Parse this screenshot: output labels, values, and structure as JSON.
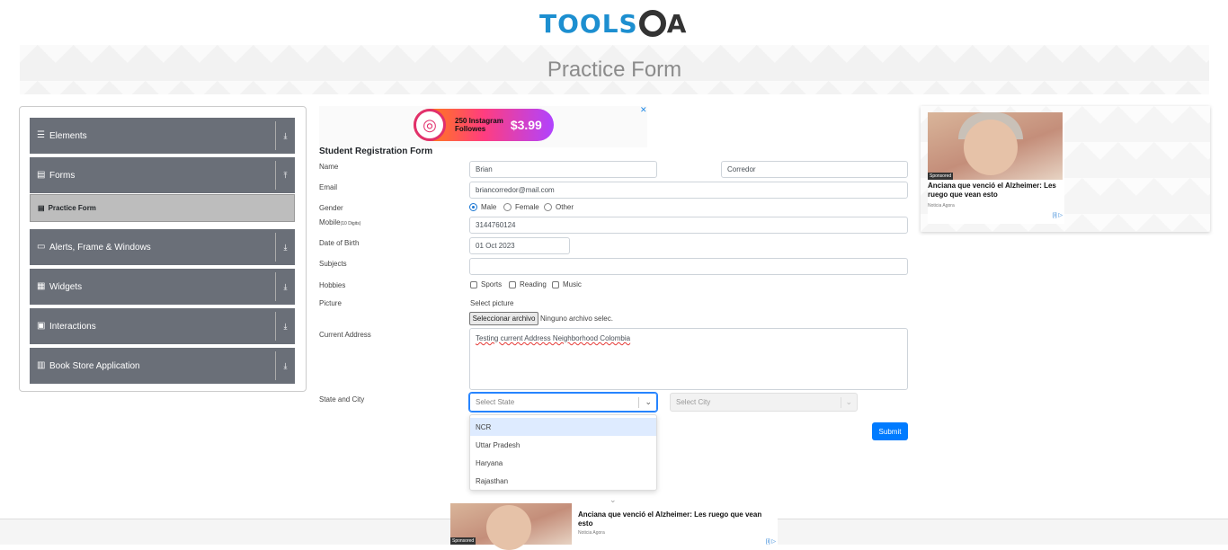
{
  "header": {
    "logo_text_left": "TOOLS",
    "logo_text_right": "A",
    "banner_title": "Practice Form"
  },
  "sidebar": {
    "groups": [
      {
        "label": "Elements",
        "icon": "menu-icon"
      },
      {
        "label": "Forms",
        "icon": "document-icon"
      },
      {
        "label": "Alerts, Frame & Windows",
        "icon": "window-icon"
      },
      {
        "label": "Widgets",
        "icon": "grid-icon"
      },
      {
        "label": "Interactions",
        "icon": "interactions-icon"
      },
      {
        "label": "Book Store Application",
        "icon": "bookstore-icon"
      }
    ],
    "active_subitem": "Practice Form"
  },
  "ad_top": {
    "text_line1": "250 Instagram",
    "text_line2": "Followes",
    "price": "$3.99",
    "close": "✕"
  },
  "form": {
    "title": "Student Registration Form",
    "labels": {
      "name": "Name",
      "email": "Email",
      "gender": "Gender",
      "mobile": "Mobile",
      "mobile_hint": "(10 Digits)",
      "dob": "Date of Birth",
      "subjects": "Subjects",
      "hobbies": "Hobbies",
      "picture": "Picture",
      "address": "Current Address",
      "state_city": "State and City"
    },
    "first_name": "Brian",
    "last_name": "Corredor",
    "email": "briancorredor@mail.com",
    "gender_options": [
      "Male",
      "Female",
      "Other"
    ],
    "gender_selected": "Male",
    "mobile": "3144760124",
    "dob": "01 Oct 2023",
    "subjects": "",
    "hobbies": [
      "Sports",
      "Reading",
      "Music"
    ],
    "picture_prompt": "Select picture",
    "file_button": "Seleccionar archivo",
    "file_status": "Ninguno archivo selec.",
    "address": "Testing current Address Neighborhood Colombia",
    "state_placeholder": "Select State",
    "city_placeholder": "Select City",
    "state_options": [
      "NCR",
      "Uttar Pradesh",
      "Haryana",
      "Rajasthan"
    ],
    "submit_label": "Submit"
  },
  "ad_right": {
    "sponsored": "Sponsored",
    "headline": "Anciana que venció el Alzheimer: Les ruego que vean esto",
    "source": "Noticia Agora",
    "choices": "[i] ▷"
  },
  "ad_bottom": {
    "sponsored": "Sponsored",
    "headline": "Anciana que venció el Alzheimer: Les ruego que vean esto",
    "source": "Noticia Agora",
    "choices": "[i] ▷"
  },
  "colors": {
    "brand_blue": "#1d8fd0",
    "sidebar_group": "#6a6f78",
    "submit": "#007bff",
    "focus": "#2684ff"
  }
}
